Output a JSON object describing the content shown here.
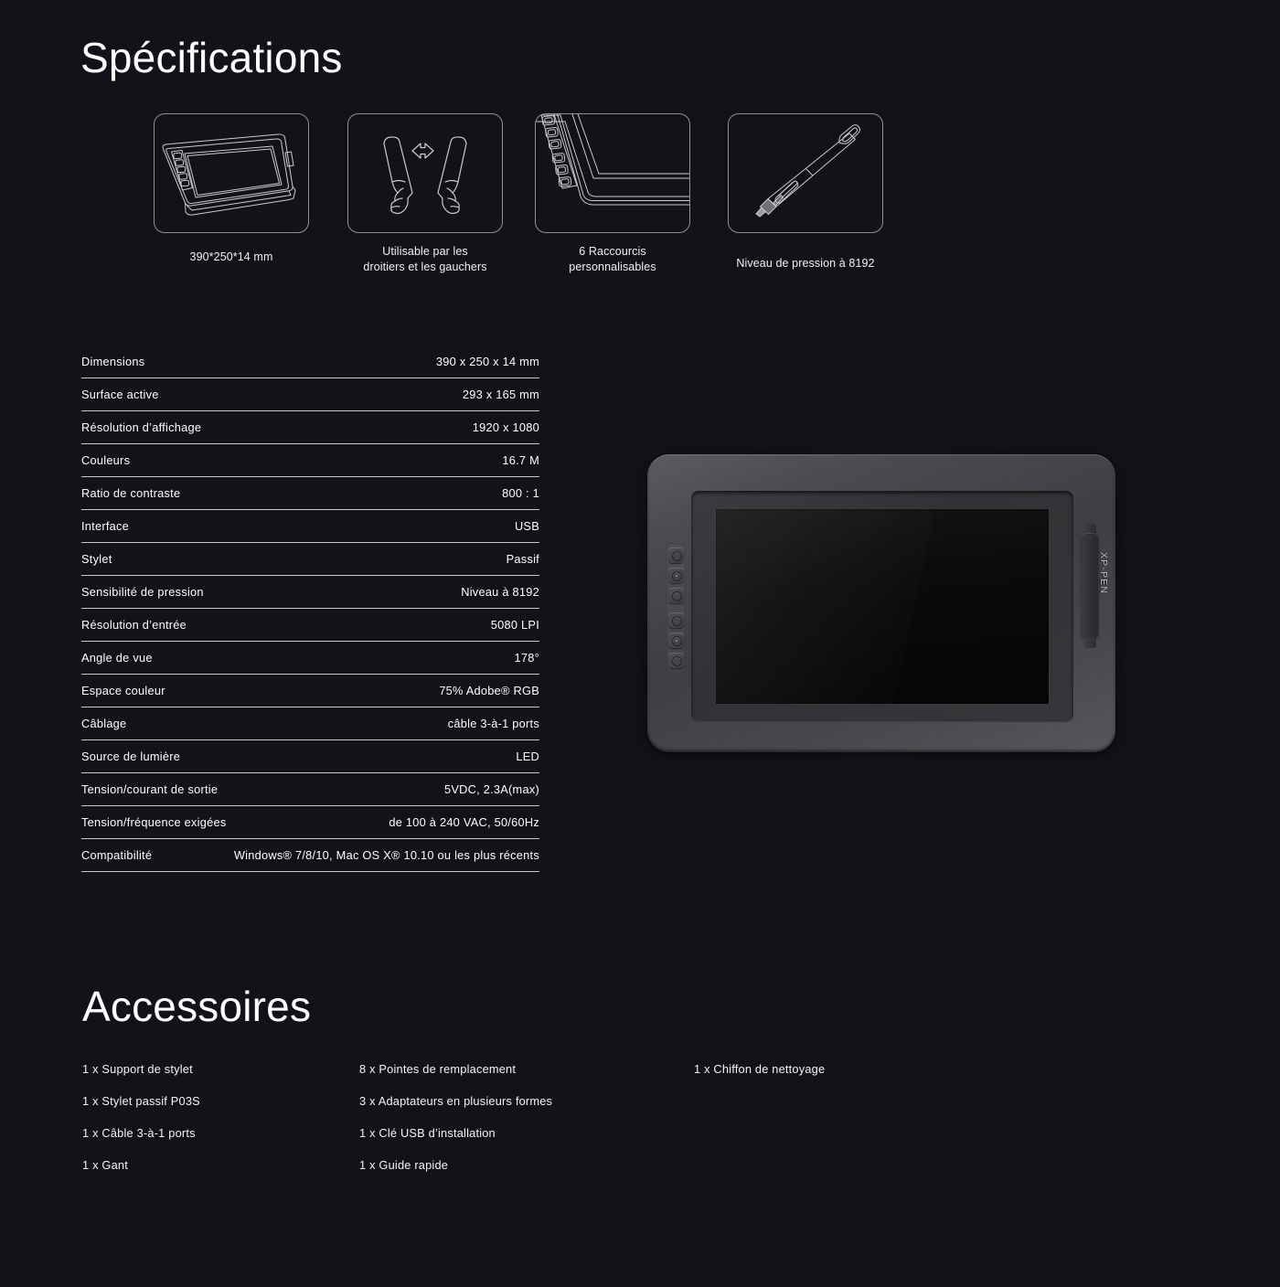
{
  "specifications": {
    "heading": "Spécifications",
    "feature_cards": [
      {
        "icon": "tablet-perspective-icon",
        "caption": "390*250*14 mm"
      },
      {
        "icon": "two-hands-arrow-icon",
        "caption": "Utilisable par les\ndroitiers et les gauchers"
      },
      {
        "icon": "tablet-shortcut-keys-icon",
        "caption": "6 Raccourcis\npersonnalisables"
      },
      {
        "icon": "stylus-pen-icon",
        "caption": "Niveau de pression à 8192"
      }
    ],
    "table_rows": [
      {
        "label": "Dimensions",
        "value": "390 x 250 x 14 mm"
      },
      {
        "label": "Surface active",
        "value": "293 x 165 mm"
      },
      {
        "label": "Résolution d’affichage",
        "value": "1920 x 1080"
      },
      {
        "label": "Couleurs",
        "value": "16.7 M"
      },
      {
        "label": "Ratio de contraste",
        "value": "800 : 1"
      },
      {
        "label": "Interface",
        "value": "USB"
      },
      {
        "label": "Stylet",
        "value": "Passif"
      },
      {
        "label": "Sensibilité de pression",
        "value": "Niveau à 8192"
      },
      {
        "label": "Résolution d’entrée",
        "value": "5080 LPI"
      },
      {
        "label": "Angle de vue",
        "value": "178°"
      },
      {
        "label": "Espace couleur",
        "value": "75% Adobe® RGB"
      },
      {
        "label": "Câblage",
        "value": "câble 3-à-1 ports"
      },
      {
        "label": "Source de lumière",
        "value": "LED"
      },
      {
        "label": "Tension/courant de sortie",
        "value": "5VDC, 2.3A(max)"
      },
      {
        "label": "Tension/fréquence exigées",
        "value": "de 100 à 240 VAC, 50/60Hz"
      },
      {
        "label": "Compatibilité",
        "value": "Windows® 7/8/10, Mac OS X® 10.10 ou les plus récents"
      }
    ]
  },
  "product_image": {
    "name": "xp-pen-drawing-tablet",
    "brand_label": "XP-PEN",
    "shortcut_button_count": 6
  },
  "accessories": {
    "heading": "Accessoires",
    "columns": [
      [
        "1 x Support de stylet",
        "1 x Stylet passif P03S",
        "1 x Câble 3-à-1 ports",
        "1 x Gant"
      ],
      [
        "8 x Pointes de remplacement",
        "3 x Adaptateurs en plusieurs formes",
        "1 x Clé USB d’installation",
        "1 x Guide rapide"
      ],
      [
        "1 x Chiffon de nettoyage"
      ]
    ]
  },
  "colors": {
    "background": "#111318",
    "text": "#ffffff",
    "rule": "#c8c8c8",
    "icon_stroke": "#c9cbce",
    "card_border": "#8e9094"
  }
}
